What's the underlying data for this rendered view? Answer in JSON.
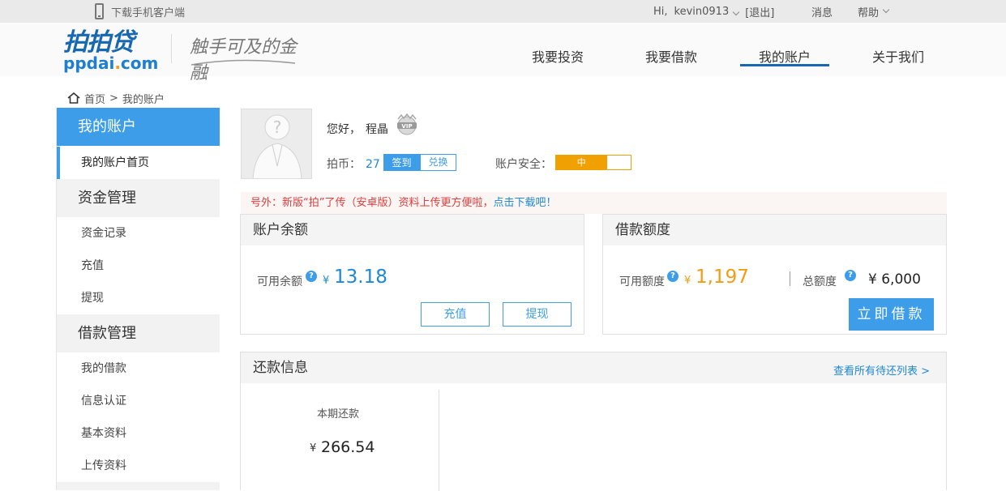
{
  "topbar": {
    "download_label": "下载手机客户端",
    "greeting_prefix": "Hi,",
    "username": "kevin0913",
    "logout": "[退出]",
    "messages": "消息",
    "help": "帮助"
  },
  "header": {
    "logo_cn": "拍拍贷",
    "logo_en_a": "ppdai",
    "logo_en_dot": ".",
    "logo_en_b": "com",
    "slogan": "触手可及的金融",
    "nav": [
      {
        "label": "我要投资"
      },
      {
        "label": "我要借款"
      },
      {
        "label": "我的账户"
      },
      {
        "label": "关于我们"
      }
    ]
  },
  "breadcrumb": {
    "home": "首页",
    "sep": ">",
    "current": "我的账户"
  },
  "sidebar": {
    "section1": "我的账户",
    "item_home": "我的账户首页",
    "section2": "资金管理",
    "item_records": "资金记录",
    "item_recharge": "充值",
    "item_withdraw": "提现",
    "section3": "借款管理",
    "item_myloans": "我的借款",
    "item_verify": "信息认证",
    "item_basic": "基本资料",
    "item_upload": "上传资料"
  },
  "profile": {
    "greeting": "您好，",
    "name": "程晶",
    "vip_label": "VIP",
    "coins_label": "拍币：",
    "coins_value": "27",
    "sign_button": "签到",
    "exchange_button": "兑换",
    "security_label": "账户安全：",
    "security_level": "中",
    "security_fill": 0.68
  },
  "notice": {
    "text": "号外：新版“拍”了传（安卓版）资料上传更方便啦，",
    "link": "点击下载吧！"
  },
  "balance": {
    "title": "账户余额",
    "available_label": "可用余额",
    "currency": "¥",
    "amount": "13.18",
    "recharge_button": "充值",
    "withdraw_button": "提现"
  },
  "credit": {
    "title": "借款额度",
    "available_label": "可用额度",
    "currency": "¥",
    "amount": "1,197",
    "total_label": "总额度",
    "total_amount": "¥ 6,000",
    "borrow_button": "立即借款"
  },
  "repayment": {
    "title": "还款信息",
    "view_all_link": "查看所有待还列表 >",
    "current_label": "本期还款",
    "currency": "¥",
    "amount": "266.54"
  },
  "colors": {
    "accent": "#3d9de8",
    "brand": "#1768b0",
    "orange": "#f39c12",
    "security": "#f0a000"
  },
  "question_icon": "?"
}
